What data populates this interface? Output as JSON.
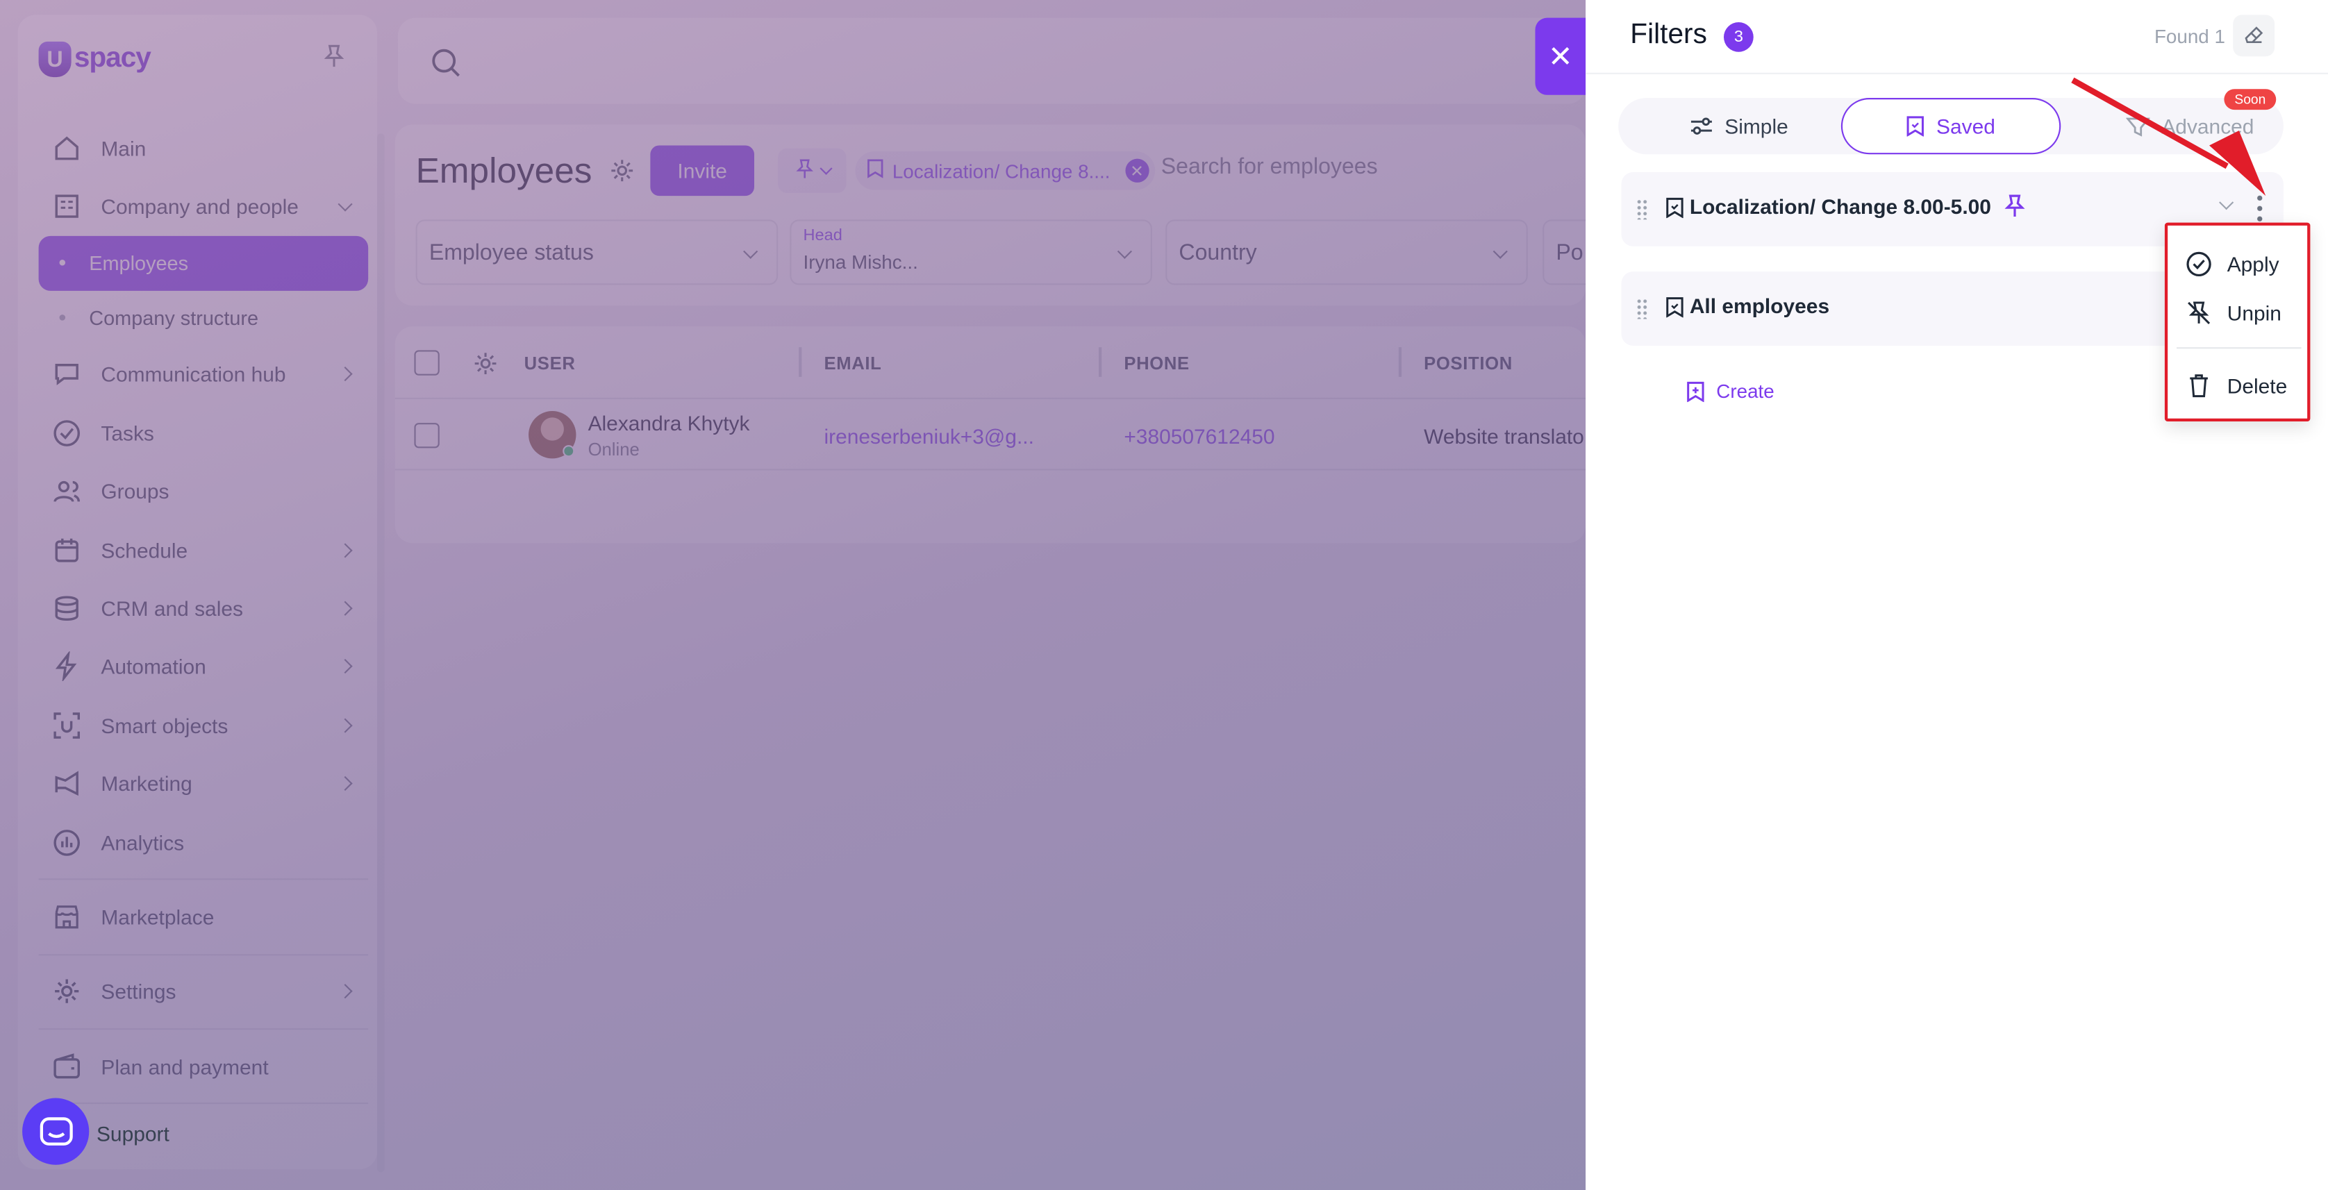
{
  "sidebar": {
    "logo_mark": "U",
    "logo_text": "spacy",
    "items": [
      {
        "label": "Main"
      },
      {
        "label": "Company and people"
      },
      {
        "label": "Employees"
      },
      {
        "label": "Company structure"
      },
      {
        "label": "Communication hub"
      },
      {
        "label": "Tasks"
      },
      {
        "label": "Groups"
      },
      {
        "label": "Schedule"
      },
      {
        "label": "CRM and sales"
      },
      {
        "label": "Automation"
      },
      {
        "label": "Smart objects"
      },
      {
        "label": "Marketing"
      },
      {
        "label": "Analytics"
      },
      {
        "label": "Marketplace"
      },
      {
        "label": "Settings"
      },
      {
        "label": "Plan and payment"
      },
      {
        "label": "Support"
      }
    ]
  },
  "page": {
    "title": "Employees",
    "invite_label": "Invite",
    "active_filter_chip": "Localization/ Change 8....",
    "search_placeholder": "Search for employees"
  },
  "filters_bar": {
    "employee_status": "Employee status",
    "head_label": "Head",
    "head_value": "Iryna Mishc...",
    "country": "Country",
    "position_cut": "Po"
  },
  "table": {
    "headers": [
      "USER",
      "EMAIL",
      "PHONE",
      "POSITION"
    ],
    "rows": [
      {
        "name": "Alexandra Khytyk",
        "status": "Online",
        "email": "ireneserbeniuk+3@g...",
        "phone": "+380507612450",
        "position": "Website translato"
      }
    ]
  },
  "panel": {
    "title": "Filters",
    "count": "3",
    "found": "Found 1",
    "tabs": {
      "simple": "Simple",
      "saved": "Saved",
      "advanced": "Advanced",
      "soon_badge": "Soon"
    },
    "saved_filters": [
      {
        "name": "Localization/ Change 8.00-5.00",
        "pinned": true
      },
      {
        "name": "All employees",
        "pinned": false
      }
    ],
    "create_label": "Create",
    "menu": {
      "apply": "Apply",
      "unpin": "Unpin",
      "delete": "Delete"
    }
  },
  "colors": {
    "accent": "#7c3aed",
    "highlight_box": "#e11d2a",
    "soon_badge": "#ef4444"
  }
}
